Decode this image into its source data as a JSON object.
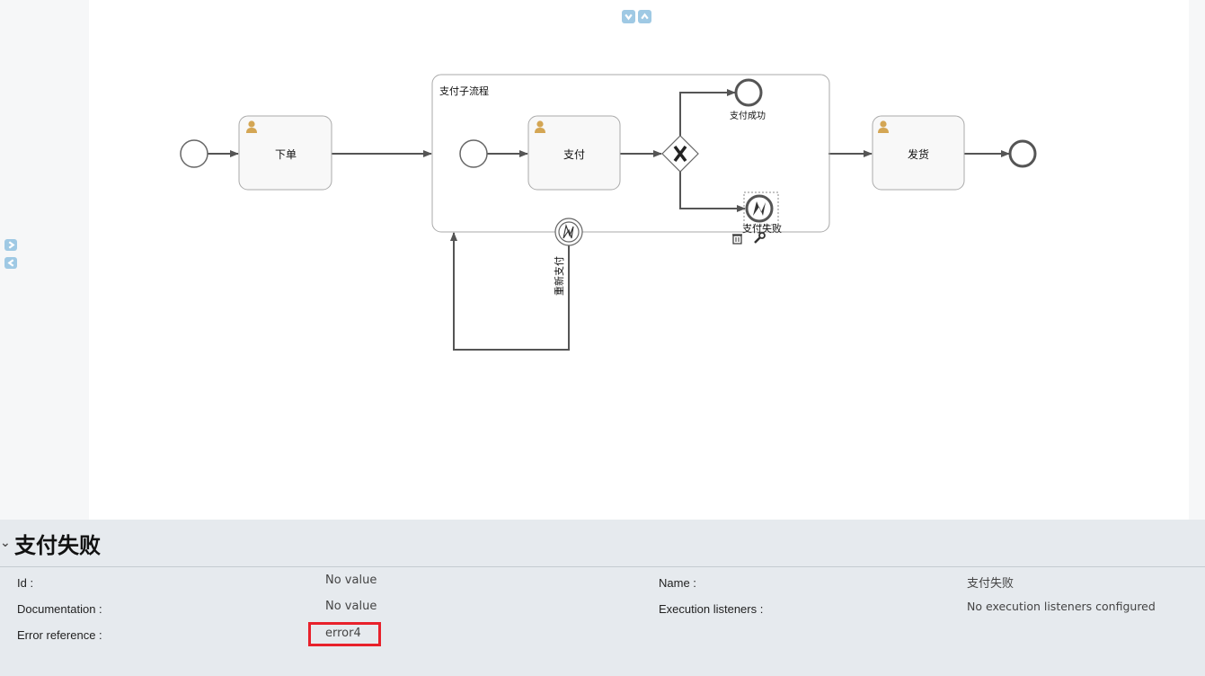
{
  "diagram": {
    "start_task_label": "下单",
    "subprocess_label": "支付子流程",
    "pay_task_label": "支付",
    "success_end_label": "支付成功",
    "fail_end_label": "支付失败",
    "boundary_label": "重新支付",
    "ship_task_label": "发货"
  },
  "properties": {
    "title": "支付失败",
    "fields": [
      {
        "label": "Id :",
        "value": "No value"
      },
      {
        "label": "Documentation :",
        "value": "No value"
      },
      {
        "label": "Error reference :",
        "value": "error4"
      },
      {
        "label": "Name :",
        "value": "支付失败"
      },
      {
        "label": "Execution listeners :",
        "value": "No execution listeners configured"
      }
    ]
  },
  "icons": {
    "user_task_icon": "user-icon",
    "gateway_icon": "exclusive-gateway-x",
    "error_event_icon": "error-lightning-icon",
    "delete_icon": "trash-icon",
    "wrench_icon": "wrench-icon"
  },
  "colors": {
    "highlight": "#e8212b",
    "collapse_buttons": "#9fc9e4",
    "user_icon": "#d4a654"
  }
}
